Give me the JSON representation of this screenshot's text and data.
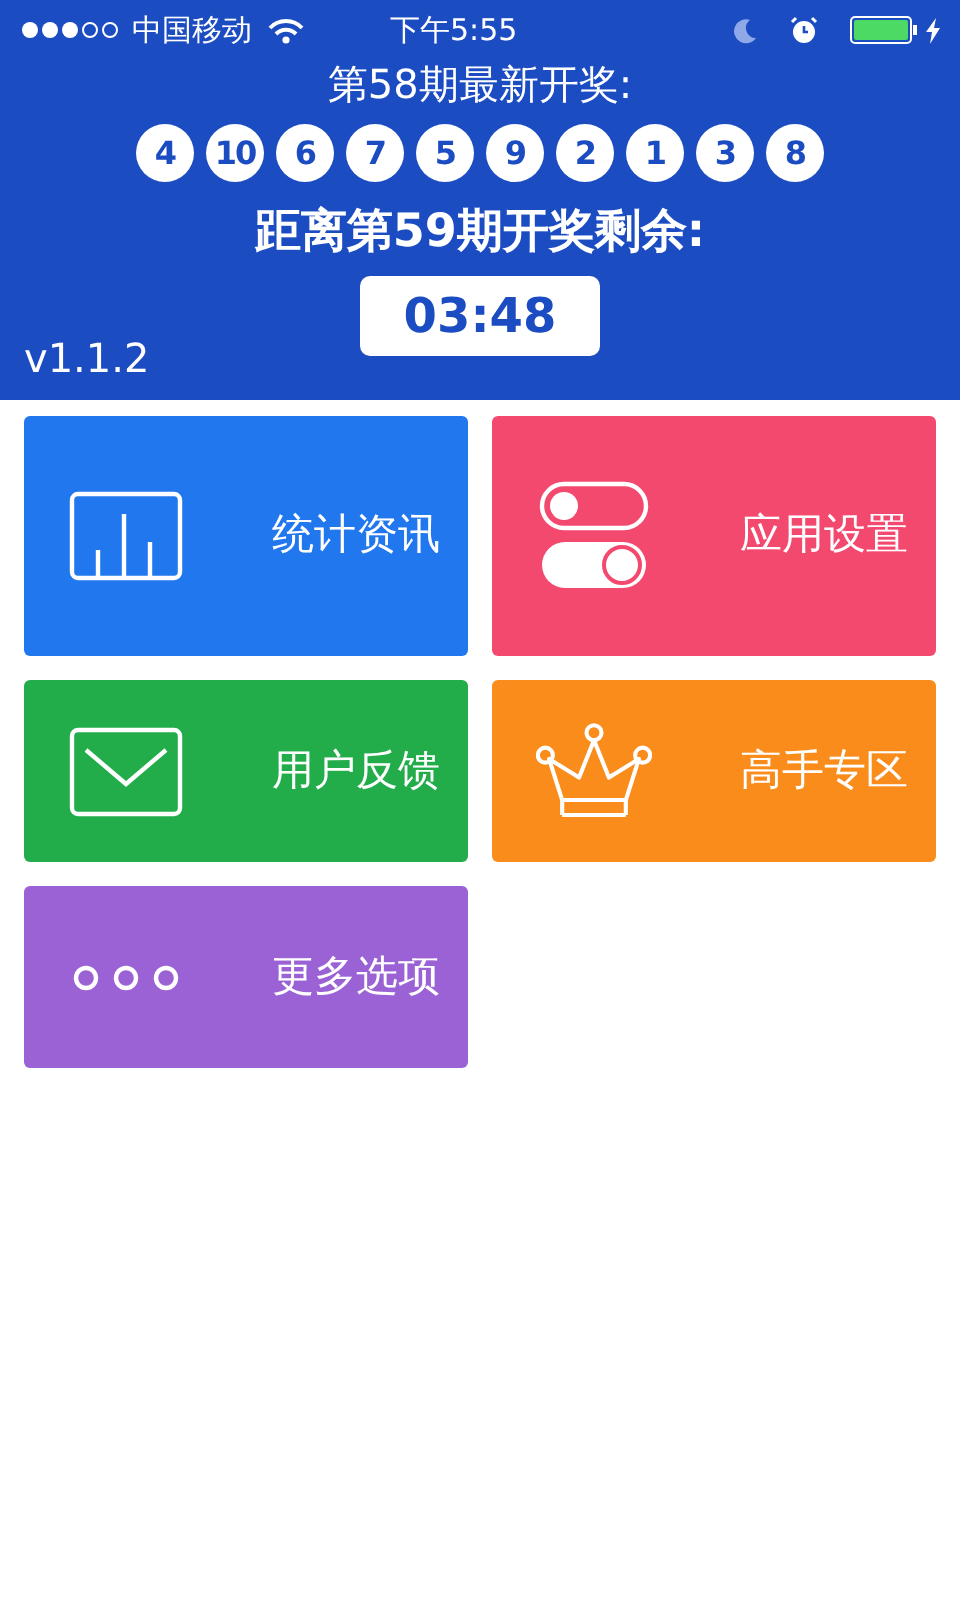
{
  "status_bar": {
    "carrier": "中国移动",
    "time": "下午5:55"
  },
  "header": {
    "latest_title": "第58期最新开奖:",
    "numbers": [
      "4",
      "10",
      "6",
      "7",
      "5",
      "9",
      "2",
      "1",
      "3",
      "8"
    ],
    "countdown_label": "距离第59期开奖剩余:",
    "countdown": "03:48",
    "version": "v1.1.2"
  },
  "tiles": [
    {
      "label": "统计资讯",
      "color": "#2178ee"
    },
    {
      "label": "应用设置",
      "color": "#f4496e"
    },
    {
      "label": "用户反馈",
      "color": "#22ad4a"
    },
    {
      "label": "高手专区",
      "color": "#fa8c1c"
    },
    {
      "label": "更多选项",
      "color": "#9a62d4"
    }
  ]
}
